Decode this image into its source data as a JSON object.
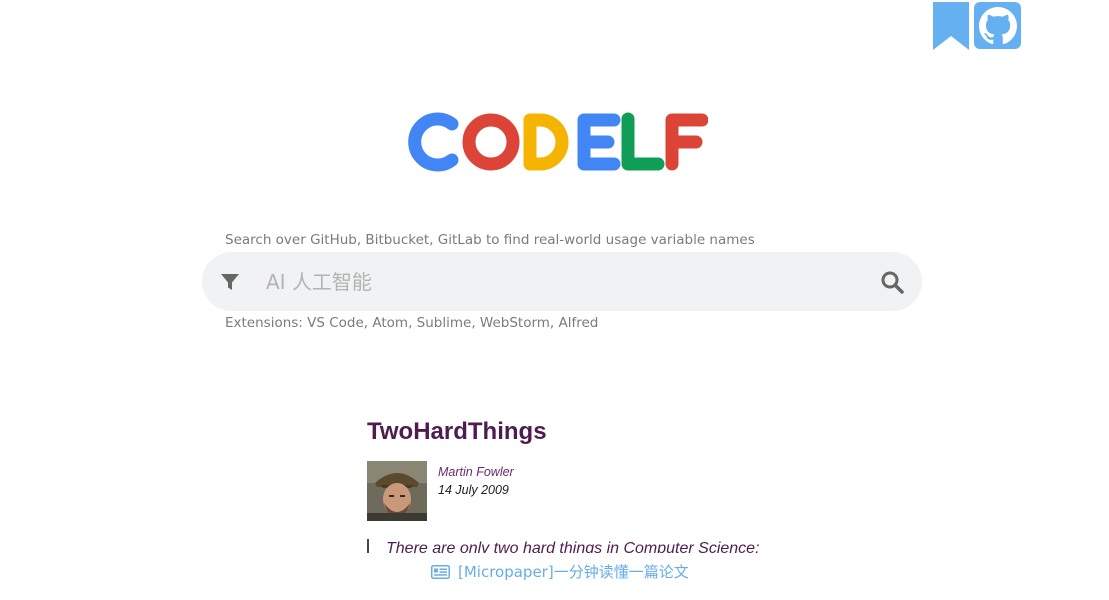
{
  "header": {
    "bookmark_icon": "bookmark-icon",
    "github_icon": "github-icon",
    "accent_color": "#64b0f0"
  },
  "logo": {
    "text": "CODELF",
    "colors": [
      "#4285f4",
      "#db4437",
      "#f4b400",
      "#4285f4",
      "#0f9d58",
      "#db4437"
    ]
  },
  "search": {
    "description": "Search over GitHub, Bitbucket, GitLab to find real-world usage variable names",
    "placeholder": "AI 人工智能",
    "value": "",
    "extensions": "Extensions: VS Code, Atom, Sublime, WebStorm, Alfred",
    "filter_icon": "filter-icon",
    "search_icon": "search-icon"
  },
  "article": {
    "title": "TwoHardThings",
    "author": "Martin Fowler",
    "date": "14 July 2009",
    "quote": "There are only two hard things in Computer Science:",
    "avatar": "author-photo"
  },
  "micropaper": {
    "icon": "newspaper-icon",
    "label": "[Micropaper]一分钟读懂一篇论文"
  }
}
